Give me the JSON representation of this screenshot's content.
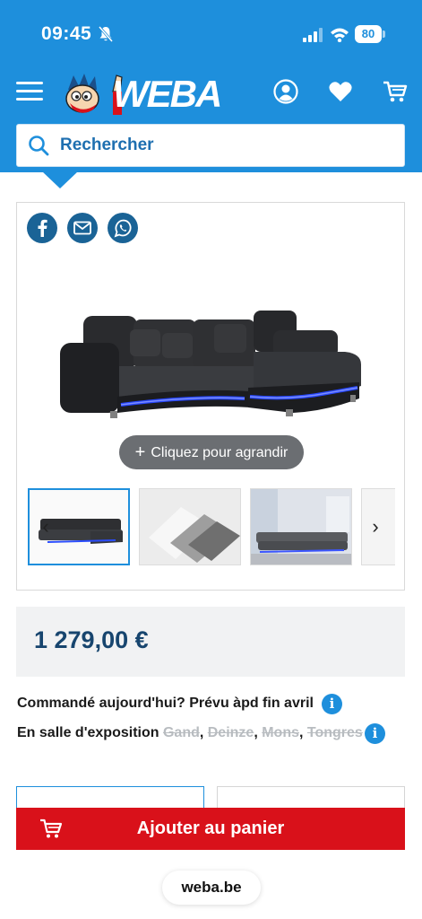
{
  "status_bar": {
    "time": "09:45",
    "battery": "80"
  },
  "header": {
    "brand": "WEBA",
    "search_placeholder": "Rechercher",
    "icons": [
      "menu-icon",
      "user-icon",
      "heart-icon",
      "cart-icon"
    ],
    "accent_color": "#1e8fdc"
  },
  "product": {
    "share_icons": [
      "facebook-icon",
      "mail-icon",
      "whatsapp-icon"
    ],
    "zoom_label": "Cliquez pour agrandir",
    "thumbnails": [
      "sofa-thumbnail",
      "fabric-swatches-thumbnail",
      "living-room-thumbnail",
      "partial-thumbnail"
    ],
    "price": "1 279,00 €",
    "delivery_text": "Commandé aujourd'hui? Prévu àpd fin avril",
    "showroom_label": "En salle d'exposition",
    "showrooms": [
      {
        "name": "Gand",
        "available": false
      },
      {
        "name": "Deinze",
        "available": false
      },
      {
        "name": "Mons",
        "available": false
      },
      {
        "name": "Tongres",
        "available": false
      }
    ],
    "add_to_cart_label": "Ajouter au panier",
    "cart_color": "#d9111a"
  },
  "browser": {
    "url": "weba.be"
  }
}
